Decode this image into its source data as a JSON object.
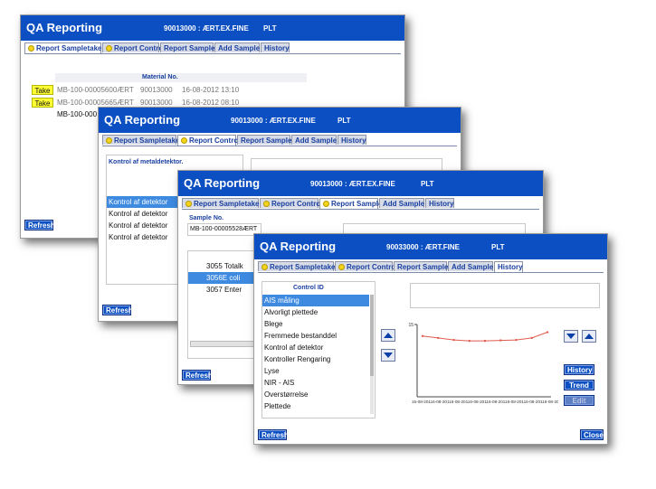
{
  "app_title": "QA Reporting",
  "plt": "PLT",
  "tabs": {
    "sampletake": "Report Sampletake",
    "control": "Report Control",
    "sample": "Report Sample",
    "add_sample": "Add Sample",
    "history": "History"
  },
  "buttons": {
    "refresh": "Refresh",
    "take": "Take",
    "history": "History",
    "trend": "Trend",
    "edit": "Edit",
    "close": "Close"
  },
  "window1": {
    "code": "90013000 : ÆRT.EX.FINE",
    "header_material": "Material No.",
    "rows": [
      {
        "sample": "MB-100-00005600ÆRT",
        "material": "90013000",
        "date": "16-08-2012 13:10",
        "take": true
      },
      {
        "sample": "MB-100-00005665ÆRT",
        "material": "90013000",
        "date": "16-08-2012 08:10",
        "take": true
      },
      {
        "sample": "MB-100-000",
        "material": "",
        "date": "",
        "take": false
      }
    ]
  },
  "window2": {
    "code": "90013000 : ÆRT.EX.FINE",
    "section_label": "Kontrol af metaldetektor.",
    "list": [
      "Kontrol af detektor",
      "Kontrol af detektor",
      "Kontrol af detektor",
      "Kontrol af detektor"
    ]
  },
  "window3": {
    "code": "90013000 : ÆRT.EX.FINE",
    "sample_label": "Sample No.",
    "sample_value": "MB-100-00005528ÆRT",
    "rows": [
      "3055 Totalk",
      "3056E coli",
      "3057 Enter"
    ]
  },
  "window4": {
    "code": "90033000 : ÆRT.FINE",
    "list_header": "Control ID",
    "list": [
      "AIS måling",
      "Alvorligt plettede",
      "Blege",
      "Fremmede bestanddel",
      "Kontrol af detektor",
      "Kontroller Rengaring",
      "Lyse",
      "NIR - AIS",
      "Overstørrelse",
      "Plettede"
    ],
    "selected_index": 0
  },
  "chart_data": {
    "type": "line",
    "y_tick": "15",
    "x_tick_text": "15-08-20116-08-20116-08-20116-08-20116-08-20116-08-20116-08-20116-08-20",
    "series": [
      {
        "values": [
          12.6,
          12.2,
          11.8,
          11.6,
          11.6,
          11.7,
          11.8,
          12.2,
          13.4
        ],
        "color": "#e05a4e"
      }
    ],
    "ylim": [
      0,
      15
    ]
  },
  "icons": {
    "up": "arrow-up-icon",
    "down": "arrow-down-icon",
    "tab_indicator": "tab-dot-icon"
  },
  "colors": {
    "title_bar": "#0b4fc3",
    "selection": "#3d8ae0",
    "take_button": "#ffff33",
    "tab_dot": "#f4d51c"
  }
}
